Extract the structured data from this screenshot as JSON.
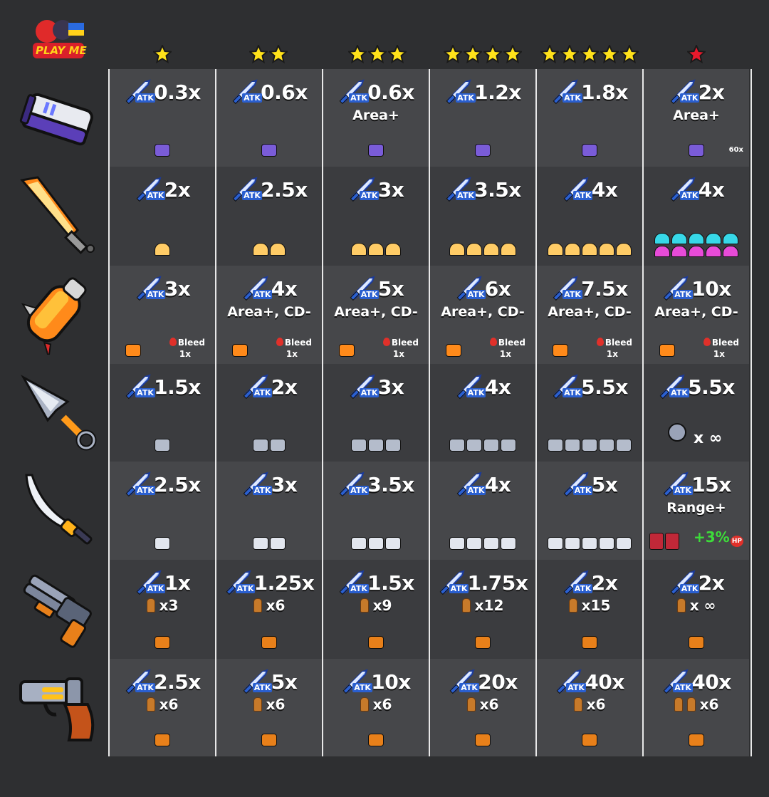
{
  "brand": {
    "logo_text": "PLAY ME"
  },
  "columns": [
    {
      "stars": 1,
      "star_color": "#ffe21a"
    },
    {
      "stars": 2,
      "star_color": "#ffe21a"
    },
    {
      "stars": 3,
      "star_color": "#ffe21a"
    },
    {
      "stars": 4,
      "star_color": "#ffe21a"
    },
    {
      "stars": 5,
      "star_color": "#ffe21a"
    },
    {
      "stars": 1,
      "star_color": "#e8192c"
    }
  ],
  "atk_label": "ATK",
  "rows": [
    {
      "weapon": "drone-gun",
      "cells": [
        {
          "mult": "0.3x"
        },
        {
          "mult": "0.6x"
        },
        {
          "mult": "0.6x",
          "extra": "Area+"
        },
        {
          "mult": "1.2x"
        },
        {
          "mult": "1.8x"
        },
        {
          "mult": "2x",
          "extra": "Area+",
          "note": "60x"
        }
      ]
    },
    {
      "weapon": "flame-sword",
      "cells": [
        {
          "mult": "2x"
        },
        {
          "mult": "2.5x"
        },
        {
          "mult": "3x"
        },
        {
          "mult": "3.5x"
        },
        {
          "mult": "4x"
        },
        {
          "mult": "4x"
        }
      ]
    },
    {
      "weapon": "spiked-club",
      "cells": [
        {
          "mult": "3x",
          "bleed": "Bleed",
          "bleed_mult": "1x"
        },
        {
          "mult": "4x",
          "extra": "Area+, CD-",
          "bleed": "Bleed",
          "bleed_mult": "1x"
        },
        {
          "mult": "5x",
          "extra": "Area+, CD-",
          "bleed": "Bleed",
          "bleed_mult": "1x"
        },
        {
          "mult": "6x",
          "extra": "Area+, CD-",
          "bleed": "Bleed",
          "bleed_mult": "1x"
        },
        {
          "mult": "7.5x",
          "extra": "Area+, CD-",
          "bleed": "Bleed",
          "bleed_mult": "1x"
        },
        {
          "mult": "10x",
          "extra": "Area+, CD-",
          "bleed": "Bleed",
          "bleed_mult": "1x"
        }
      ]
    },
    {
      "weapon": "kunai",
      "cells": [
        {
          "mult": "1.5x"
        },
        {
          "mult": "2x"
        },
        {
          "mult": "3x"
        },
        {
          "mult": "4x"
        },
        {
          "mult": "5.5x"
        },
        {
          "mult": "5.5x",
          "note": "x ∞"
        }
      ]
    },
    {
      "weapon": "katana",
      "cells": [
        {
          "mult": "2.5x"
        },
        {
          "mult": "3x"
        },
        {
          "mult": "3.5x"
        },
        {
          "mult": "4x"
        },
        {
          "mult": "5x"
        },
        {
          "mult": "15x",
          "extra": "Range+",
          "note": "+3%",
          "note2": "HP"
        }
      ]
    },
    {
      "weapon": "shotgun",
      "cells": [
        {
          "mult": "1x",
          "ammo": "x3"
        },
        {
          "mult": "1.25x",
          "ammo": "x6"
        },
        {
          "mult": "1.5x",
          "ammo": "x9"
        },
        {
          "mult": "1.75x",
          "ammo": "x12"
        },
        {
          "mult": "2x",
          "ammo": "x15"
        },
        {
          "mult": "2x",
          "ammo": "x ∞"
        }
      ]
    },
    {
      "weapon": "revolver",
      "cells": [
        {
          "mult": "2.5x",
          "ammo": "x6"
        },
        {
          "mult": "5x",
          "ammo": "x6"
        },
        {
          "mult": "10x",
          "ammo": "x6"
        },
        {
          "mult": "20x",
          "ammo": "x6"
        },
        {
          "mult": "40x",
          "ammo": "x6"
        },
        {
          "mult": "40x",
          "ammo": "x6"
        }
      ]
    }
  ]
}
